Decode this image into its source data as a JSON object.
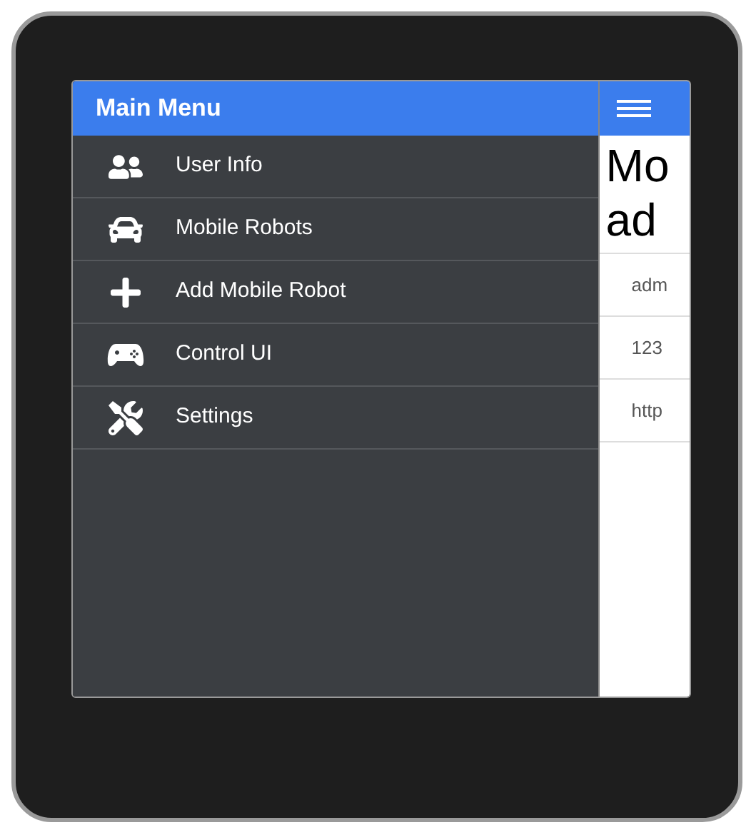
{
  "menu": {
    "title": "Main Menu",
    "items": [
      {
        "label": "User Info"
      },
      {
        "label": "Mobile Robots"
      },
      {
        "label": "Add Mobile Robot"
      },
      {
        "label": "Control UI"
      },
      {
        "label": "Settings"
      }
    ]
  },
  "content": {
    "heading": [
      "Mo",
      "ad"
    ],
    "rows": [
      "adm",
      "123",
      "http"
    ]
  }
}
